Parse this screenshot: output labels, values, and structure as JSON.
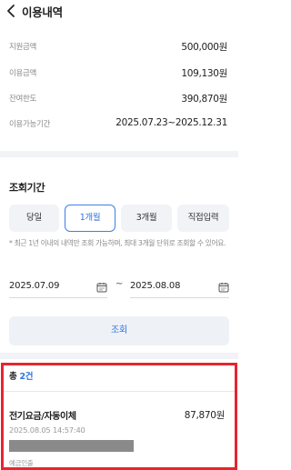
{
  "header": {
    "title": "이용내역",
    "back_icon": "chevron-left-icon"
  },
  "summary": [
    {
      "label": "지원금액",
      "value": "500,000원"
    },
    {
      "label": "이용금액",
      "value": "109,130원"
    },
    {
      "label": "잔여한도",
      "value": "390,870원"
    },
    {
      "label": "이용가능기간",
      "value": "2025.07.23~2025.12.31"
    }
  ],
  "search": {
    "section_title": "조회기간",
    "periods": [
      "당일",
      "1개월",
      "3개월",
      "직접입력"
    ],
    "selected_period": "1개월",
    "notice": "* 최근 1년 이내의 내역만 조회 가능하며, 최대 3개월 단위로 조회할 수 있어요.",
    "start_date": "2025.07.09",
    "end_date": "2025.08.08",
    "separator": "~",
    "calendar_icon": "calendar-icon",
    "submit_label": "조회"
  },
  "results": {
    "total_prefix": "총 ",
    "total_count": "2건",
    "items": [
      {
        "name": "전기요금/자동이체",
        "amount": "87,870원",
        "datetime": "2025.08.05 14:57:40",
        "type": "예금인출"
      }
    ]
  },
  "colors": {
    "accent": "#2f74e0",
    "highlight_border": "#e6252e",
    "divider": "#f2f3f6"
  }
}
